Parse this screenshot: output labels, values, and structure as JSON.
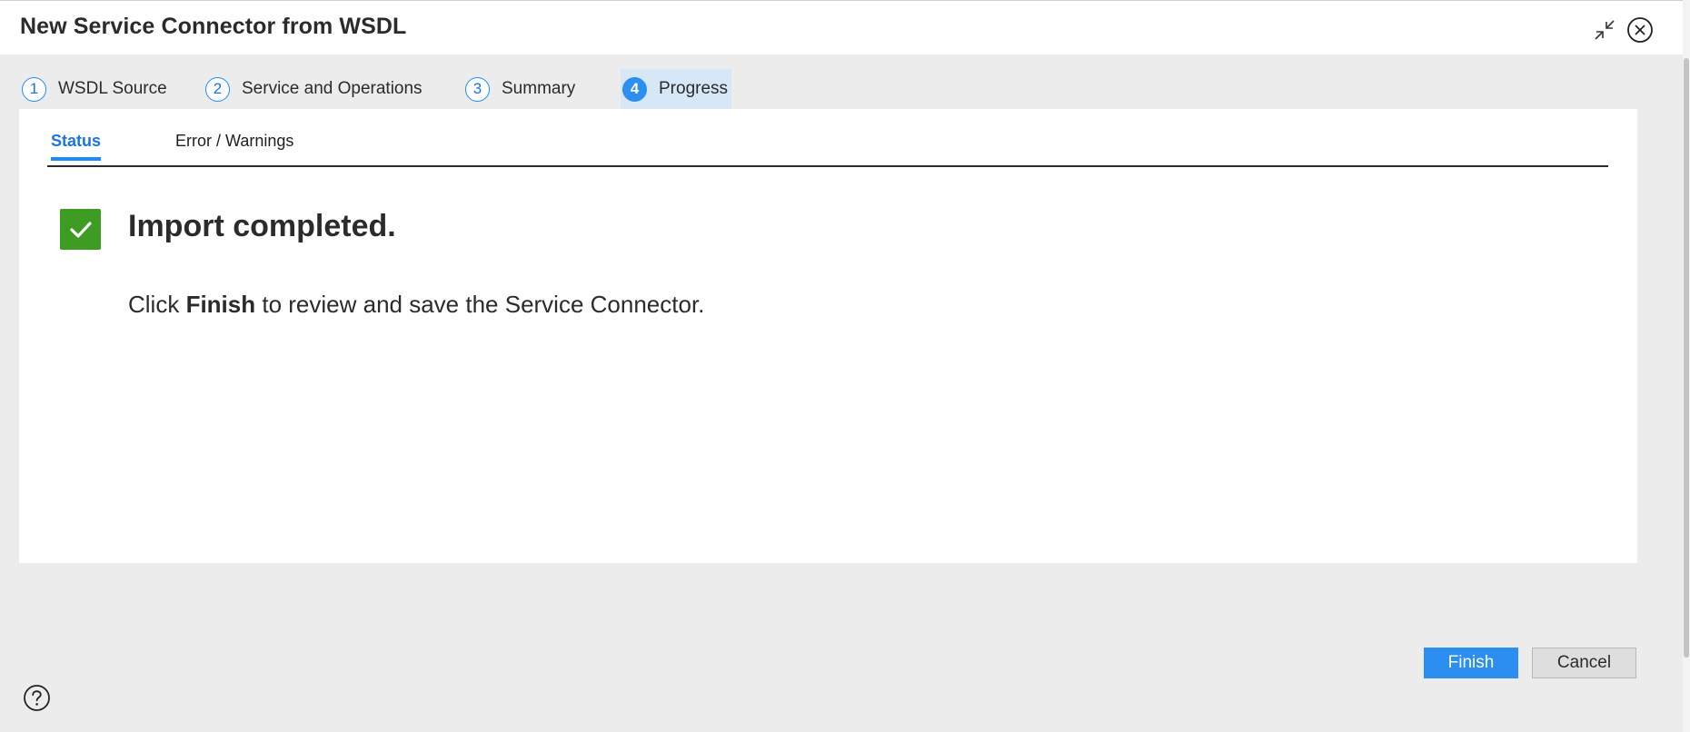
{
  "dialog": {
    "title": "New Service Connector from WSDL"
  },
  "steps": [
    {
      "number": "1",
      "label": "WSDL Source"
    },
    {
      "number": "2",
      "label": "Service and Operations"
    },
    {
      "number": "3",
      "label": "Summary"
    },
    {
      "number": "4",
      "label": "Progress"
    }
  ],
  "active_step": "4",
  "tabs": [
    {
      "label": "Status"
    },
    {
      "label": "Error / Warnings"
    }
  ],
  "active_tab": "Status",
  "status": {
    "heading": "Import completed.",
    "message_before": "Click ",
    "message_bold": "Finish",
    "message_after": " to review and save the Service Connector.",
    "icon": "checkmark-icon",
    "color": "#3e9c22"
  },
  "buttons": {
    "finish_label": "Finish",
    "cancel_label": "Cancel"
  },
  "icons": {
    "collapse": "collapse-arrows-icon",
    "close": "close-circle-icon",
    "help": "help-circle-icon"
  },
  "colors": {
    "accent": "#2b8ef0",
    "active_step_bg": "#d6e7f7",
    "success": "#3e9c22"
  }
}
